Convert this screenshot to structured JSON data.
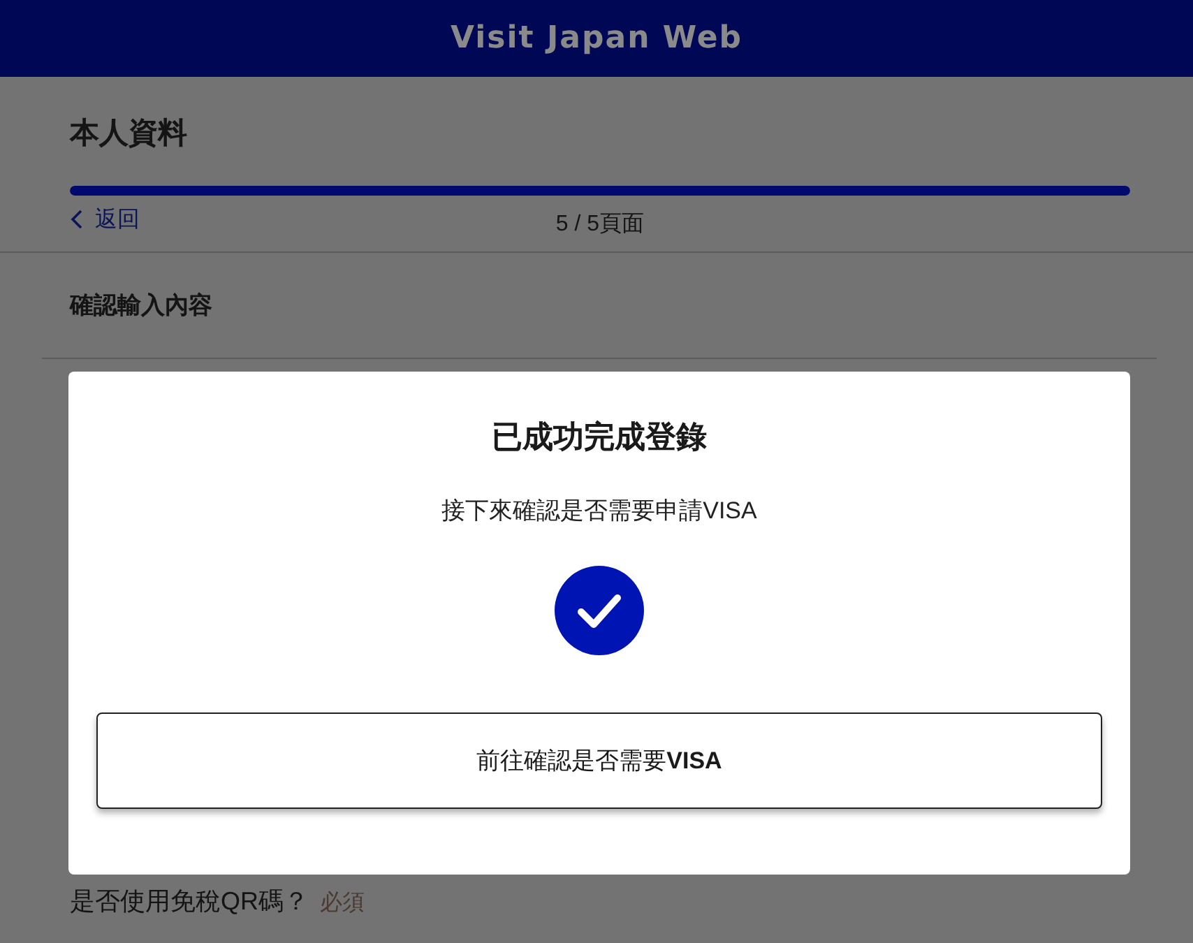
{
  "header": {
    "title": "Visit Japan Web"
  },
  "page": {
    "title": "本人資料",
    "progress": {
      "level": 1
    },
    "back_link": "返回",
    "page_counter": "5 / 5頁面",
    "section_title": "確認輸入內容",
    "question": {
      "label": "是否使用免稅QR碼？",
      "required": "必須"
    }
  },
  "dialog": {
    "title": "已成功完成登錄",
    "message": "接下來確認是否需要申請VISA",
    "button": {
      "label": "前往確認是否需要**VISA**"
    }
  }
}
